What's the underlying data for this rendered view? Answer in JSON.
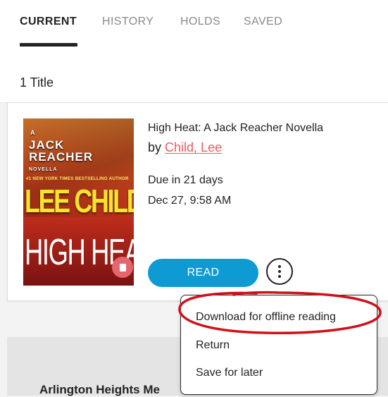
{
  "tabs": [
    {
      "label": "CURRENT",
      "active": true
    },
    {
      "label": "HISTORY",
      "active": false
    },
    {
      "label": "HOLDS",
      "active": false
    },
    {
      "label": "SAVED",
      "active": false
    }
  ],
  "title_count": "1 Title",
  "book": {
    "title": "High Heat: A Jack Reacher Novella",
    "by_prefix": "by",
    "author": "Child, Lee",
    "due_in": "Due in 21 days",
    "due_date": "Dec 27, 9:58 AM",
    "read_label": "READ",
    "cover": {
      "series_a": "A",
      "series": "JACK REACHER",
      "novella": "NOVELLA",
      "tagline": "#1 NEW YORK TIMES BESTSELLING AUTHOR",
      "author": "LEE CHILD",
      "title": "HIGH HEAT"
    }
  },
  "menu": {
    "items": [
      "Download for offline reading",
      "Return",
      "Save for later"
    ]
  },
  "library_name": "Arlington Heights Me",
  "colors": {
    "accent": "#0e9bd3",
    "link": "#e85b63",
    "annotation": "#d0101a"
  },
  "icons": {
    "more": "more-vertical-icon",
    "format": "ebook-format-icon"
  }
}
